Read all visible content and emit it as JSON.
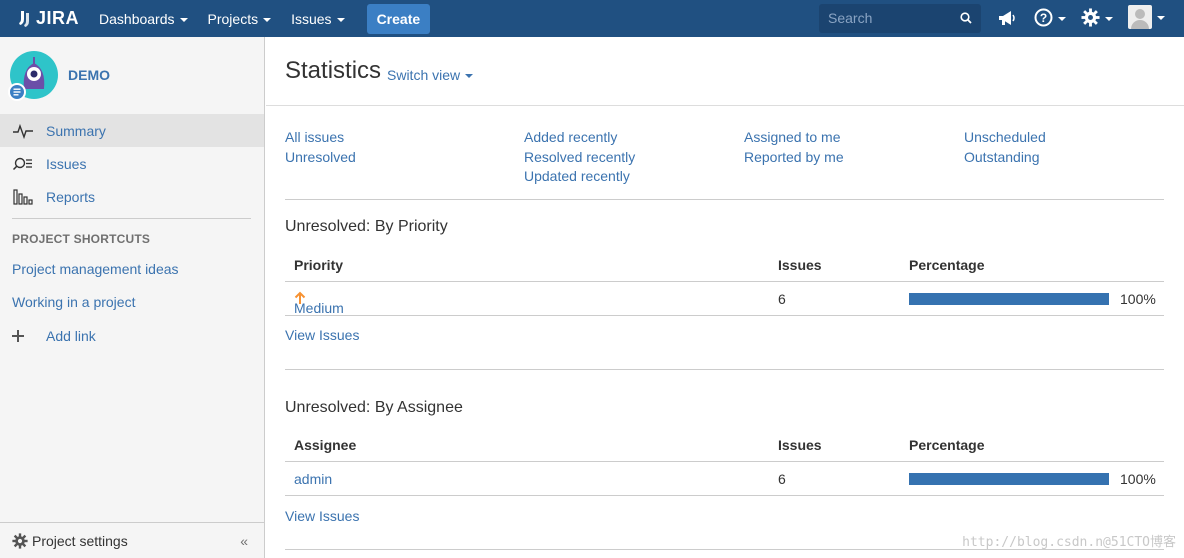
{
  "topnav": {
    "logo_text": "JIRA",
    "menus": [
      "Dashboards",
      "Projects",
      "Issues"
    ],
    "create_label": "Create",
    "search_placeholder": "Search",
    "bg_color": "#205081",
    "icons": [
      "megaphone-icon",
      "help-icon",
      "gear-icon",
      "user-avatar"
    ]
  },
  "sidebar": {
    "project_name": "DEMO",
    "nav": [
      {
        "label": "Summary",
        "icon": "activity-icon",
        "active": true
      },
      {
        "label": "Issues",
        "icon": "issues-search-icon",
        "active": false
      },
      {
        "label": "Reports",
        "icon": "reports-chart-icon",
        "active": false
      }
    ],
    "shortcuts_heading": "PROJECT SHORTCUTS",
    "shortcuts": [
      "Project management ideas",
      "Working in a project"
    ],
    "add_link": "Add link",
    "settings_label": "Project settings",
    "collapse_glyph": "«"
  },
  "main": {
    "title": "Statistics",
    "switch_view": "Switch view",
    "filters": [
      [
        "All issues",
        "Unresolved"
      ],
      [
        "Added recently",
        "Resolved recently",
        "Updated recently"
      ],
      [
        "Assigned to me",
        "Reported by me"
      ],
      [
        "Unscheduled",
        "Outstanding"
      ]
    ],
    "priority_section": {
      "title": "Unresolved: By Priority",
      "headers": [
        "Priority",
        "Issues",
        "Percentage"
      ],
      "rows": [
        {
          "name": "Medium",
          "issues": "6",
          "percent": "100%",
          "fraction": 1.0
        }
      ],
      "view_issues": "View Issues"
    },
    "assignee_section": {
      "title": "Unresolved: By Assignee",
      "headers": [
        "Assignee",
        "Issues",
        "Percentage"
      ],
      "rows": [
        {
          "name": "admin",
          "issues": "6",
          "percent": "100%",
          "fraction": 1.0
        }
      ],
      "view_issues": "View Issues"
    }
  },
  "watermark": "http://blog.csdn.n@51CTO博客"
}
